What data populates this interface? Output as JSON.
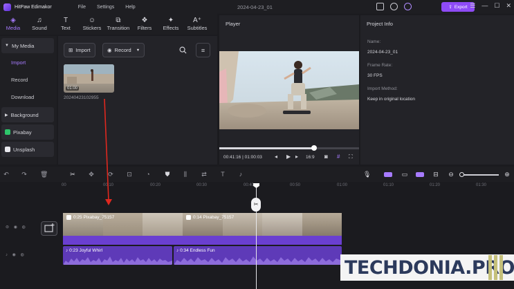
{
  "app": {
    "name": "HitPaw Edimakor",
    "document_title": "2024-04-23_01",
    "menu": [
      "File",
      "Settings",
      "Help"
    ],
    "export_label": "Export"
  },
  "toolbar": {
    "items": [
      {
        "label": "Media",
        "icon": "media-icon",
        "active": true
      },
      {
        "label": "Sound",
        "icon": "music-note-icon"
      },
      {
        "label": "Text",
        "icon": "text-icon"
      },
      {
        "label": "Stickers",
        "icon": "sticker-icon"
      },
      {
        "label": "Transition",
        "icon": "transition-icon"
      },
      {
        "label": "Filters",
        "icon": "filter-icon"
      },
      {
        "label": "Effects",
        "icon": "sparkle-icon"
      },
      {
        "label": "Subtitles",
        "icon": "subtitle-icon"
      }
    ]
  },
  "sidebar": {
    "my_media": "My Media",
    "sub_items": [
      "Import",
      "Record",
      "Download"
    ],
    "active_sub": "Import",
    "background": "Background",
    "pixabay": "Pixabay",
    "unsplash": "Unsplash"
  },
  "media_panel": {
    "import_label": "Import",
    "record_label": "Record",
    "clip": {
      "duration": "01:00",
      "name": "20240423102955"
    }
  },
  "player": {
    "title": "Player",
    "current_time": "00:41:16",
    "total_time": "01:00:03",
    "aspect": "16:9",
    "progress_fraction": 0.68
  },
  "project_info": {
    "title": "Project Info",
    "fields": [
      {
        "label": "Name:",
        "value": "2024-04-23_01"
      },
      {
        "label": "Frame Rate:",
        "value": "30 FPS"
      },
      {
        "label": "Import Method:",
        "value": "Keep in original location"
      }
    ]
  },
  "timeline": {
    "ruler_ticks": [
      "00",
      "00:10",
      "00:20",
      "00:30",
      "00:40",
      "00:50",
      "01:00",
      "01:10",
      "01:20",
      "01:30"
    ],
    "video_clips": [
      {
        "label": "0:25 Pixabay_75157"
      },
      {
        "label": "0:14 Pixabay_75157"
      }
    ],
    "audio_clips": [
      {
        "label": "0:23 Joyful Whirl"
      },
      {
        "label": "0:34 Endless Fun"
      }
    ]
  },
  "watermark": {
    "text": "TECHDONIA.PRO"
  },
  "colors": {
    "accent": "#a77bff",
    "export": "#8e4bf5",
    "clip": "#6a3fd0",
    "arrow": "#e0281f"
  }
}
